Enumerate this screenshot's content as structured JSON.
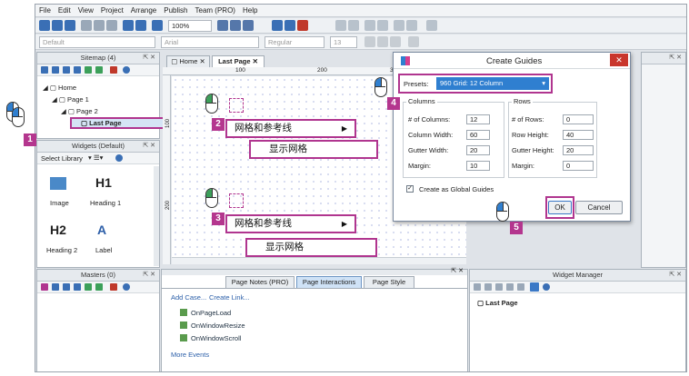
{
  "menu": [
    "File",
    "Edit",
    "View",
    "Project",
    "Arrange",
    "Publish",
    "Team (PRO)",
    "Help"
  ],
  "toolbar": {
    "zoom": "100%",
    "style": "Default",
    "font": "Arial",
    "weight": "Regular",
    "size": "13"
  },
  "sitemap": {
    "title": "Sitemap (4)",
    "items": [
      "Home",
      "Page 1",
      "Page 2",
      "Last Page"
    ]
  },
  "widgets": {
    "title": "Widgets (Default)",
    "library": "Select Library",
    "items": [
      {
        "icon": "image-icon",
        "label": "Image"
      },
      {
        "icon": "H1",
        "label": "Heading 1"
      },
      {
        "icon": "H2",
        "label": "Heading 2"
      },
      {
        "icon": "label-icon",
        "label": "Label"
      }
    ]
  },
  "masters": {
    "title": "Masters (0)"
  },
  "tabs": [
    "Home",
    "Last Page"
  ],
  "ruler": [
    "100",
    "200",
    "300"
  ],
  "vruler": [
    "100",
    "200"
  ],
  "context_menu": {
    "grid_guides": "网格和参考线",
    "show_grid": "显示网格"
  },
  "badges": [
    "1",
    "2",
    "3",
    "4",
    "5"
  ],
  "dialog": {
    "title": "Create Guides",
    "presets_label": "Presets:",
    "presets_value": "960 Grid: 12 Column",
    "columns": {
      "title": "Columns",
      "rows": [
        {
          "label": "# of Columns:",
          "value": "12"
        },
        {
          "label": "Column Width:",
          "value": "60"
        },
        {
          "label": "Gutter Width:",
          "value": "20"
        },
        {
          "label": "Margin:",
          "value": "10"
        }
      ]
    },
    "rows": {
      "title": "Rows",
      "rows": [
        {
          "label": "# of Rows:",
          "value": "0"
        },
        {
          "label": "Row Height:",
          "value": "40"
        },
        {
          "label": "Gutter Height:",
          "value": "20"
        },
        {
          "label": "Margin:",
          "value": "0"
        }
      ]
    },
    "global_label": "Create as Global Guides",
    "ok": "OK",
    "cancel": "Cancel"
  },
  "bottom_tabs": [
    "Page Notes (PRO)",
    "Page Interactions",
    "Page Style"
  ],
  "interactions": {
    "add_case": "Add Case...",
    "create_link": "Create Link...",
    "events": [
      "OnPageLoad",
      "OnWindowResize",
      "OnWindowScroll"
    ],
    "more": "More Events"
  },
  "widget_manager": {
    "title": "Widget Manager",
    "page": "Last Page"
  }
}
